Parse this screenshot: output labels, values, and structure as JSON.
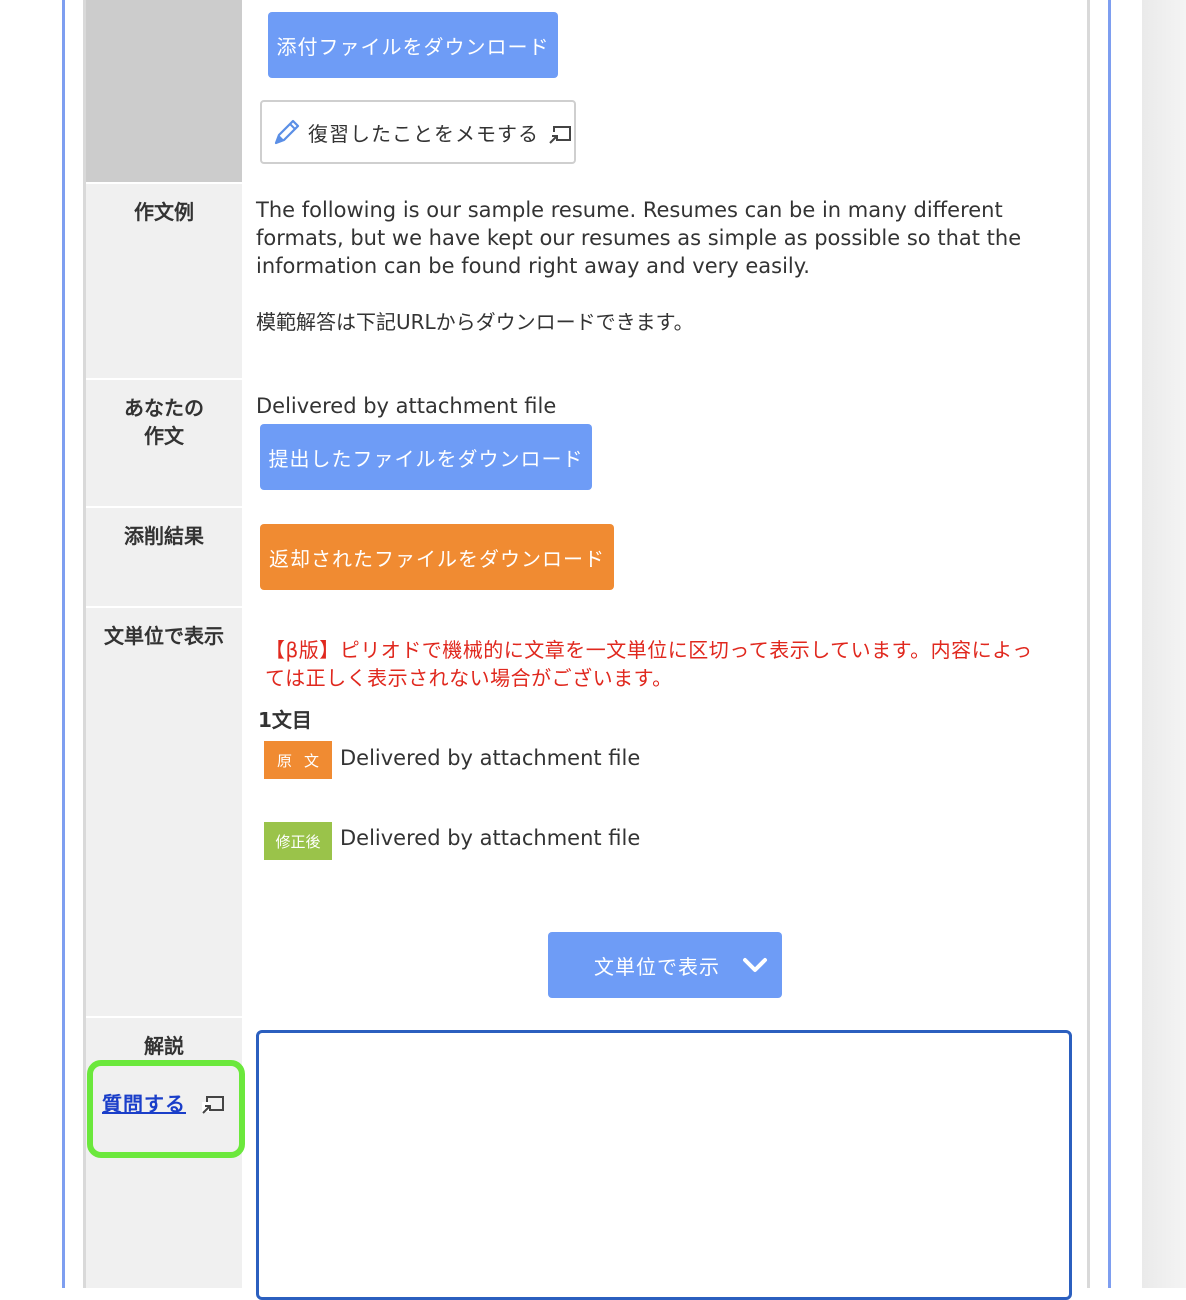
{
  "buttons": {
    "attachment_download": "添付ファイルをダウンロード",
    "review_memo": "復習したことをメモする",
    "submitted_download": "提出したファイルをダウンロード",
    "returned_download": "返却されたファイルをダウンロード",
    "sentence_toggle": "文単位で表示"
  },
  "rows": {
    "sample": {
      "label": "作文例",
      "text_en_1": "The following is our sample resume. Resumes can be in many different",
      "text_en_2": "formats, but we have kept our resumes as simple as possible so that the",
      "text_en_3": "information can be found right away and very easily.",
      "text_ja": "模範解答は下記URLからダウンロードできます。"
    },
    "yours": {
      "label_1": "あなたの",
      "label_2": "作文",
      "text": "Delivered by attachment file"
    },
    "correction": {
      "label": "添削結果"
    },
    "sentence": {
      "label": "文単位で表示",
      "beta_note_1": "【β版】ピリオドで機械的に文章を一文単位に区切って表示しています。内容によっ",
      "beta_note_2": "ては正しく表示されない場合がございます。",
      "item_heading": "1文目",
      "original_tag": "原文",
      "original_text": "Delivered by attachment file",
      "fixed_tag": "修正後",
      "fixed_text": "Delivered by attachment file"
    },
    "explanation": {
      "label": "解説",
      "question_link": "質問する"
    }
  },
  "colors": {
    "primary_button": "#6e9cf6",
    "returned_button": "#f08b32",
    "original_tag": "#f08b32",
    "fixed_tag": "#9ac34a",
    "beta_note": "#e0281e",
    "link": "#1a3ec9",
    "highlight": "#6be83c"
  },
  "icons": [
    "pencil-icon",
    "external-window-icon",
    "chevron-down-icon"
  ]
}
